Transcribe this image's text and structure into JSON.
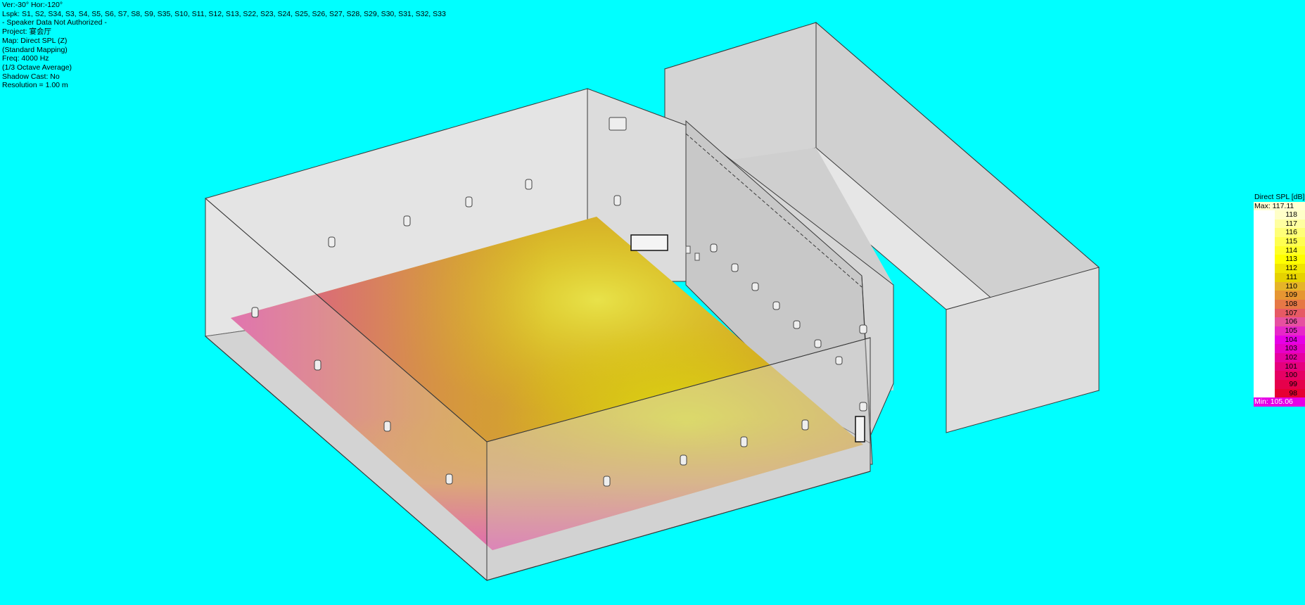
{
  "info": {
    "view": "Ver:-30°   Hor:-120°",
    "loudspeakers": "Lspk: S1, S2, S34, S3, S4, S5, S6, S7, S8, S9, S35, S10, S11, S12, S13, S22, S23, S24, S25, S26, S27, S28, S29, S30, S31, S32, S33",
    "notice": "- Speaker Data Not Authorized -",
    "project": "Project: 宴会厅",
    "map": "Map: Direct SPL (Z)",
    "mapping": "(Standard Mapping)",
    "freq": "Freq: 4000 Hz",
    "averaging": "(1/3 Octave Average)",
    "shadow": "Shadow Cast: No",
    "resolution": "Resolution =   1.00 m"
  },
  "legend": {
    "title": "Direct SPL [dB]",
    "max_label": "Max:  117.11",
    "min_label": "Min:  105.06",
    "levels": [
      {
        "value": "118",
        "color": "#FFFFC8"
      },
      {
        "value": "117",
        "color": "#FFFFA0"
      },
      {
        "value": "116",
        "color": "#FFFF78"
      },
      {
        "value": "115",
        "color": "#FFFF50"
      },
      {
        "value": "114",
        "color": "#FFFF28"
      },
      {
        "value": "113",
        "color": "#FFFF00"
      },
      {
        "value": "112",
        "color": "#F0E600"
      },
      {
        "value": "111",
        "color": "#E6D200"
      },
      {
        "value": "110",
        "color": "#E6B428"
      },
      {
        "value": "109",
        "color": "#E69632"
      },
      {
        "value": "108",
        "color": "#E67846"
      },
      {
        "value": "107",
        "color": "#E65A64"
      },
      {
        "value": "106",
        "color": "#E650A0"
      },
      {
        "value": "105",
        "color": "#E628C8"
      },
      {
        "value": "104",
        "color": "#E600E6"
      },
      {
        "value": "103",
        "color": "#E600C8"
      },
      {
        "value": "102",
        "color": "#E600A0"
      },
      {
        "value": "101",
        "color": "#E6007D"
      },
      {
        "value": "100",
        "color": "#E60064"
      },
      {
        "value": "99",
        "color": "#E6004B"
      },
      {
        "value": "98",
        "color": "#E60032"
      }
    ]
  },
  "colors": {
    "background": "#00FFFF",
    "wall": "#D9D9D9",
    "edge": "#3A3A3A"
  }
}
